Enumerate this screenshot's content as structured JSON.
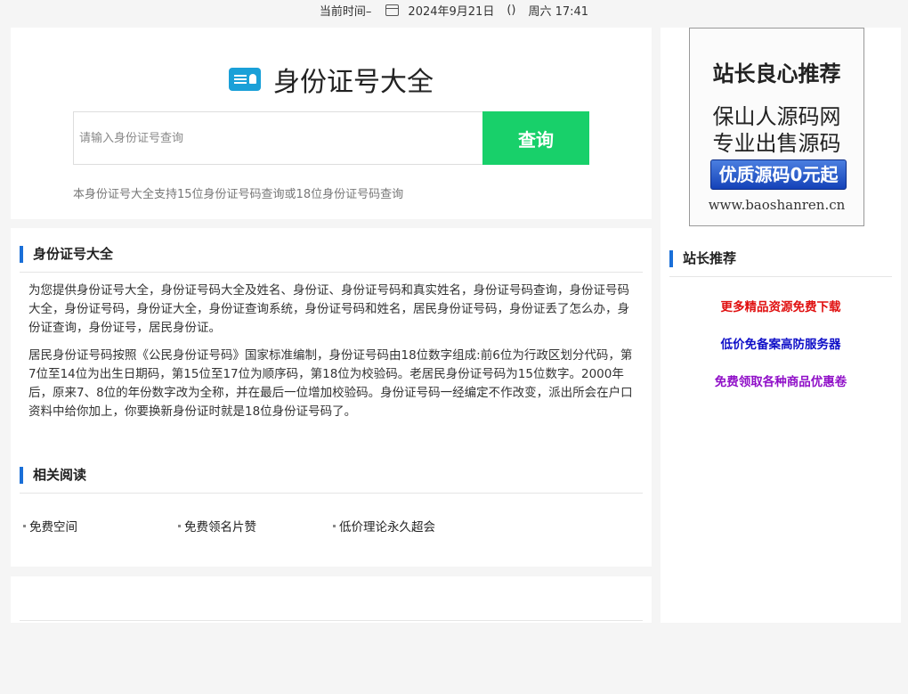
{
  "topbar": {
    "time_label": "当前时间–",
    "date": "2024年9月21日",
    "paren": "()",
    "weekday_time": "周六 17:41"
  },
  "search": {
    "title": "身份证号大全",
    "placeholder": "请输入身份证号查询",
    "button_label": "查询",
    "note": "本身份证号大全支持15位身份证号码查询或18位身份证号码查询"
  },
  "intro": {
    "heading": "身份证号大全",
    "para1": "为您提供身份证号大全，身份证号码大全及姓名、身份证、身份证号码和真实姓名，身份证号码查询，身份证号码大全，身份证号码，身份证大全，身份证查询系统，身份证号码和姓名，居民身份证号码，身份证丢了怎么办，身份证查询，身份证号，居民身份证。",
    "para2": "居民身份证号码按照《公民身份证号码》国家标准编制，身份证号码由18位数字组成:前6位为行政区划分代码，第7位至14位为出生日期码，第15位至17位为顺序码，第18位为校验码。老居民身份证号码为15位数字。2000年后，原来7、8位的年份数字改为全称，并在最后一位增加校验码。身份证号码一经编定不作改变，派出所会在户口资料中给你加上，你要换新身份证时就是18位身份证号码了。"
  },
  "related": {
    "heading": "相关阅读",
    "items": [
      "免费空间",
      "免费领名片赞",
      "低价理论永久超会"
    ]
  },
  "ad": {
    "line1": "站长良心推荐",
    "line2": "保山人源码网",
    "line3": "专业出售源码",
    "button": "优质源码0元起",
    "url": "www.baoshanren.cn"
  },
  "recommend": {
    "heading": "站长推荐",
    "links": [
      {
        "label": "更多精品资源免费下载",
        "color": "#e01010"
      },
      {
        "label": "低价免备案高防服务器",
        "color": "#1010c8"
      },
      {
        "label": "免费领取各种商品优惠卷",
        "color": "#9010c8"
      }
    ]
  }
}
